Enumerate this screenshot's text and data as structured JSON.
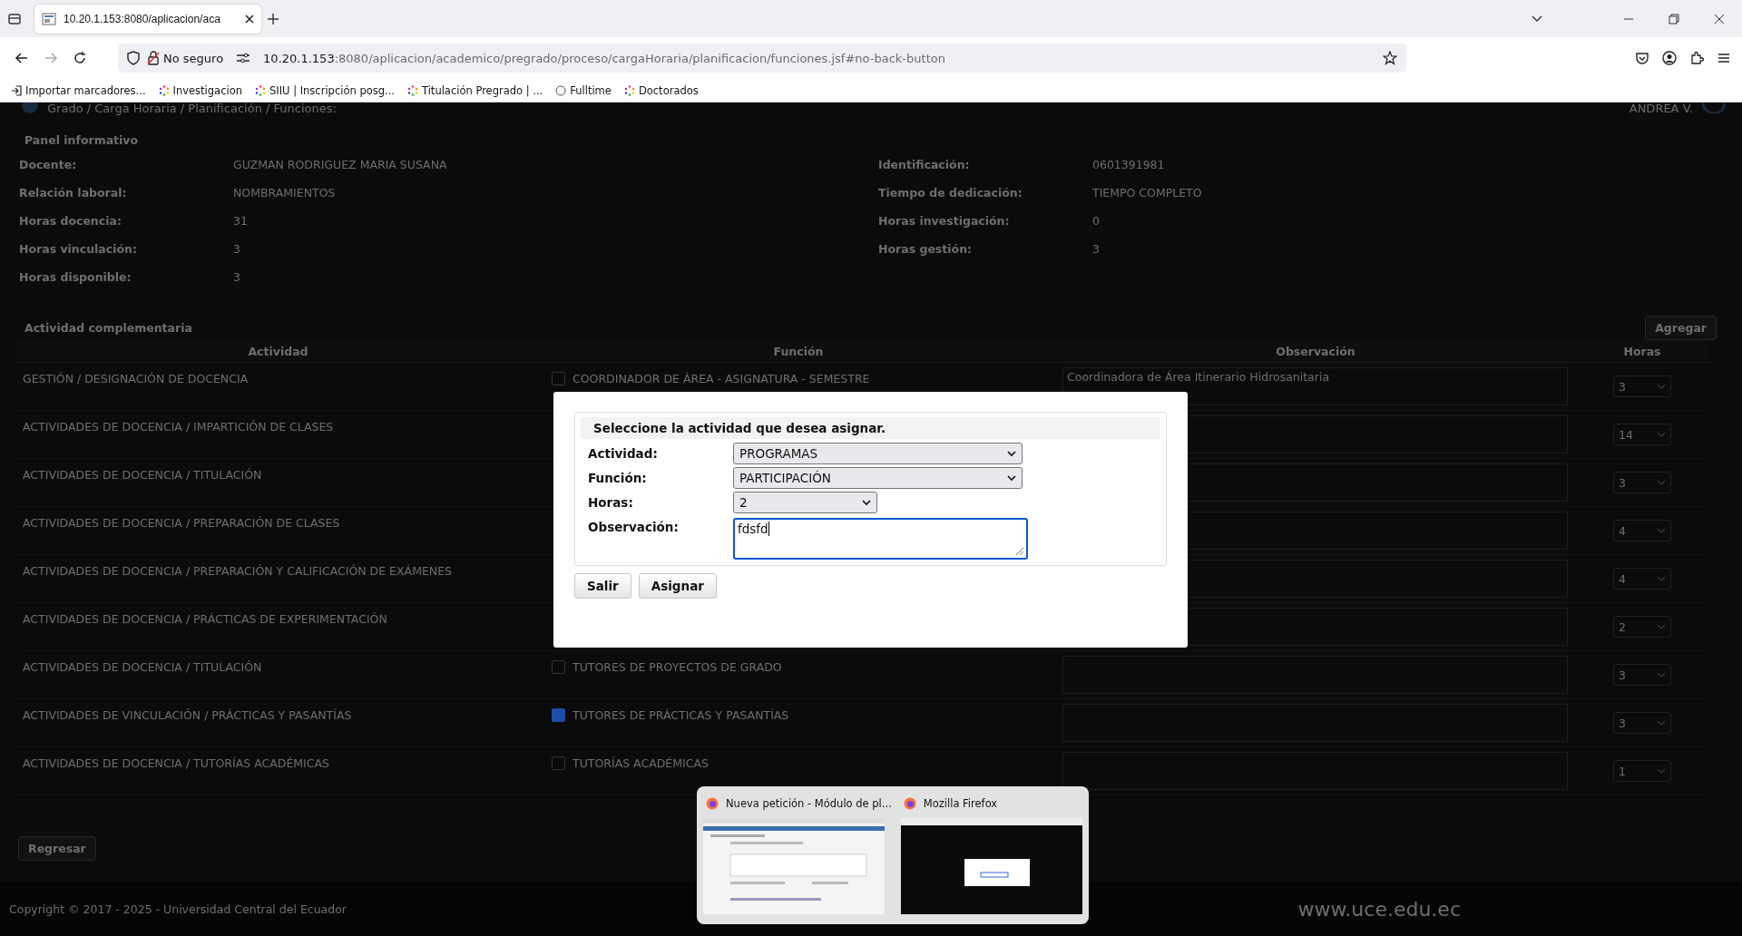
{
  "browser": {
    "tab_title": "10.20.1.153:8080/aplicacion/aca",
    "security": "No seguro",
    "url_host": "10.20.1.153",
    "url_rest": ":8080/aplicacion/academico/pregrado/proceso/cargaHoraria/planificacion/funciones.jsf#no-back-button",
    "bookmarks": [
      {
        "label": "Importar marcadores...",
        "kind": "import"
      },
      {
        "label": "Investigacion",
        "kind": "loading"
      },
      {
        "label": "SIIU | Inscripción posg...",
        "kind": "loading"
      },
      {
        "label": "Titulación Pregrado | ...",
        "kind": "loading"
      },
      {
        "label": "Fulltime",
        "kind": "globe"
      },
      {
        "label": "Doctorados",
        "kind": "loading"
      }
    ]
  },
  "page": {
    "breadcrumb": "Grado / Carga Horaria / Planificación / Funciones:",
    "user": "ANDREA V.",
    "panel_title": "Panel informativo",
    "info_left": [
      {
        "label": "Docente:",
        "value": "GUZMAN RODRIGUEZ MARIA SUSANA"
      },
      {
        "label": "Relación laboral:",
        "value": "NOMBRAMIENTOS"
      },
      {
        "label": "Horas docencia:",
        "value": "31"
      },
      {
        "label": "Horas vinculación:",
        "value": "3"
      },
      {
        "label": "Horas disponible:",
        "value": "3"
      }
    ],
    "info_right": [
      {
        "label": "Identificación:",
        "value": "0601391981"
      },
      {
        "label": "Tiempo de dedicación:",
        "value": "TIEMPO COMPLETO"
      },
      {
        "label": "Horas investigación:",
        "value": "0"
      },
      {
        "label": "Horas gestión:",
        "value": "3"
      }
    ],
    "section_title": "Actividad complementaria",
    "add_button": "Agregar",
    "table": {
      "columns": [
        "Actividad",
        "Función",
        "Observación",
        "Horas"
      ],
      "rows": [
        {
          "activity": "GESTIÓN / DESIGNACIÓN DE DOCENCIA",
          "function": "COORDINADOR DE ÁREA - ASIGNATURA - SEMESTRE",
          "checked": false,
          "observation": "Coordinadora de Área Itinerario Hidrosanitaria",
          "hours": "3"
        },
        {
          "activity": "ACTIVIDADES DE DOCENCIA / IMPARTICIÓN DE CLASES",
          "hours": "14"
        },
        {
          "activity": "ACTIVIDADES DE DOCENCIA / TITULACIÓN",
          "hours": "3"
        },
        {
          "activity": "ACTIVIDADES DE DOCENCIA / PREPARACIÓN DE CLASES",
          "hours": "4"
        },
        {
          "activity": "ACTIVIDADES DE DOCENCIA / PREPARACIÓN Y CALIFICACIÓN DE EXÁMENES",
          "hours": "4"
        },
        {
          "activity": "ACTIVIDADES DE DOCENCIA / PRÁCTICAS DE EXPERIMENTACIÓN",
          "hours": "2"
        },
        {
          "activity": "ACTIVIDADES DE DOCENCIA / TITULACIÓN",
          "function": "TUTORES DE PROYECTOS DE GRADO",
          "checked": false,
          "hours": "3"
        },
        {
          "activity": "ACTIVIDADES DE VINCULACIÓN / PRÁCTICAS Y PASANTÍAS",
          "function": "TUTORES DE PRÁCTICAS Y PASANTÍAS",
          "checked": true,
          "hours": "3"
        },
        {
          "activity": "ACTIVIDADES DE DOCENCIA / TUTORÍAS ACADÉMICAS",
          "function": "TUTORÍAS ACADÉMICAS",
          "checked": false,
          "hours": "1"
        }
      ]
    },
    "back_button": "Regresar",
    "footer": {
      "copyright": "Copyright © 2017 - 2025 - Universidad Central del Ecuador",
      "website": "www.uce.edu.ec"
    }
  },
  "dialog": {
    "title": "Seleccione la actividad que desea asignar.",
    "fields": [
      {
        "label": "Actividad:",
        "kind": "select",
        "value": "PROGRAMAS"
      },
      {
        "label": "Función:",
        "kind": "select",
        "value": "PARTICIPACIÓN"
      },
      {
        "label": "Horas:",
        "kind": "select-short",
        "value": "2"
      },
      {
        "label": "Observación:",
        "kind": "textarea",
        "value": "fdsfd"
      }
    ],
    "buttons": [
      "Salir",
      "Asignar"
    ]
  },
  "taskbar_preview": {
    "windows": [
      {
        "title": "Nueva petición - Módulo de pl...",
        "kind": "page"
      },
      {
        "title": "Mozilla Firefox",
        "kind": "modal"
      }
    ]
  }
}
